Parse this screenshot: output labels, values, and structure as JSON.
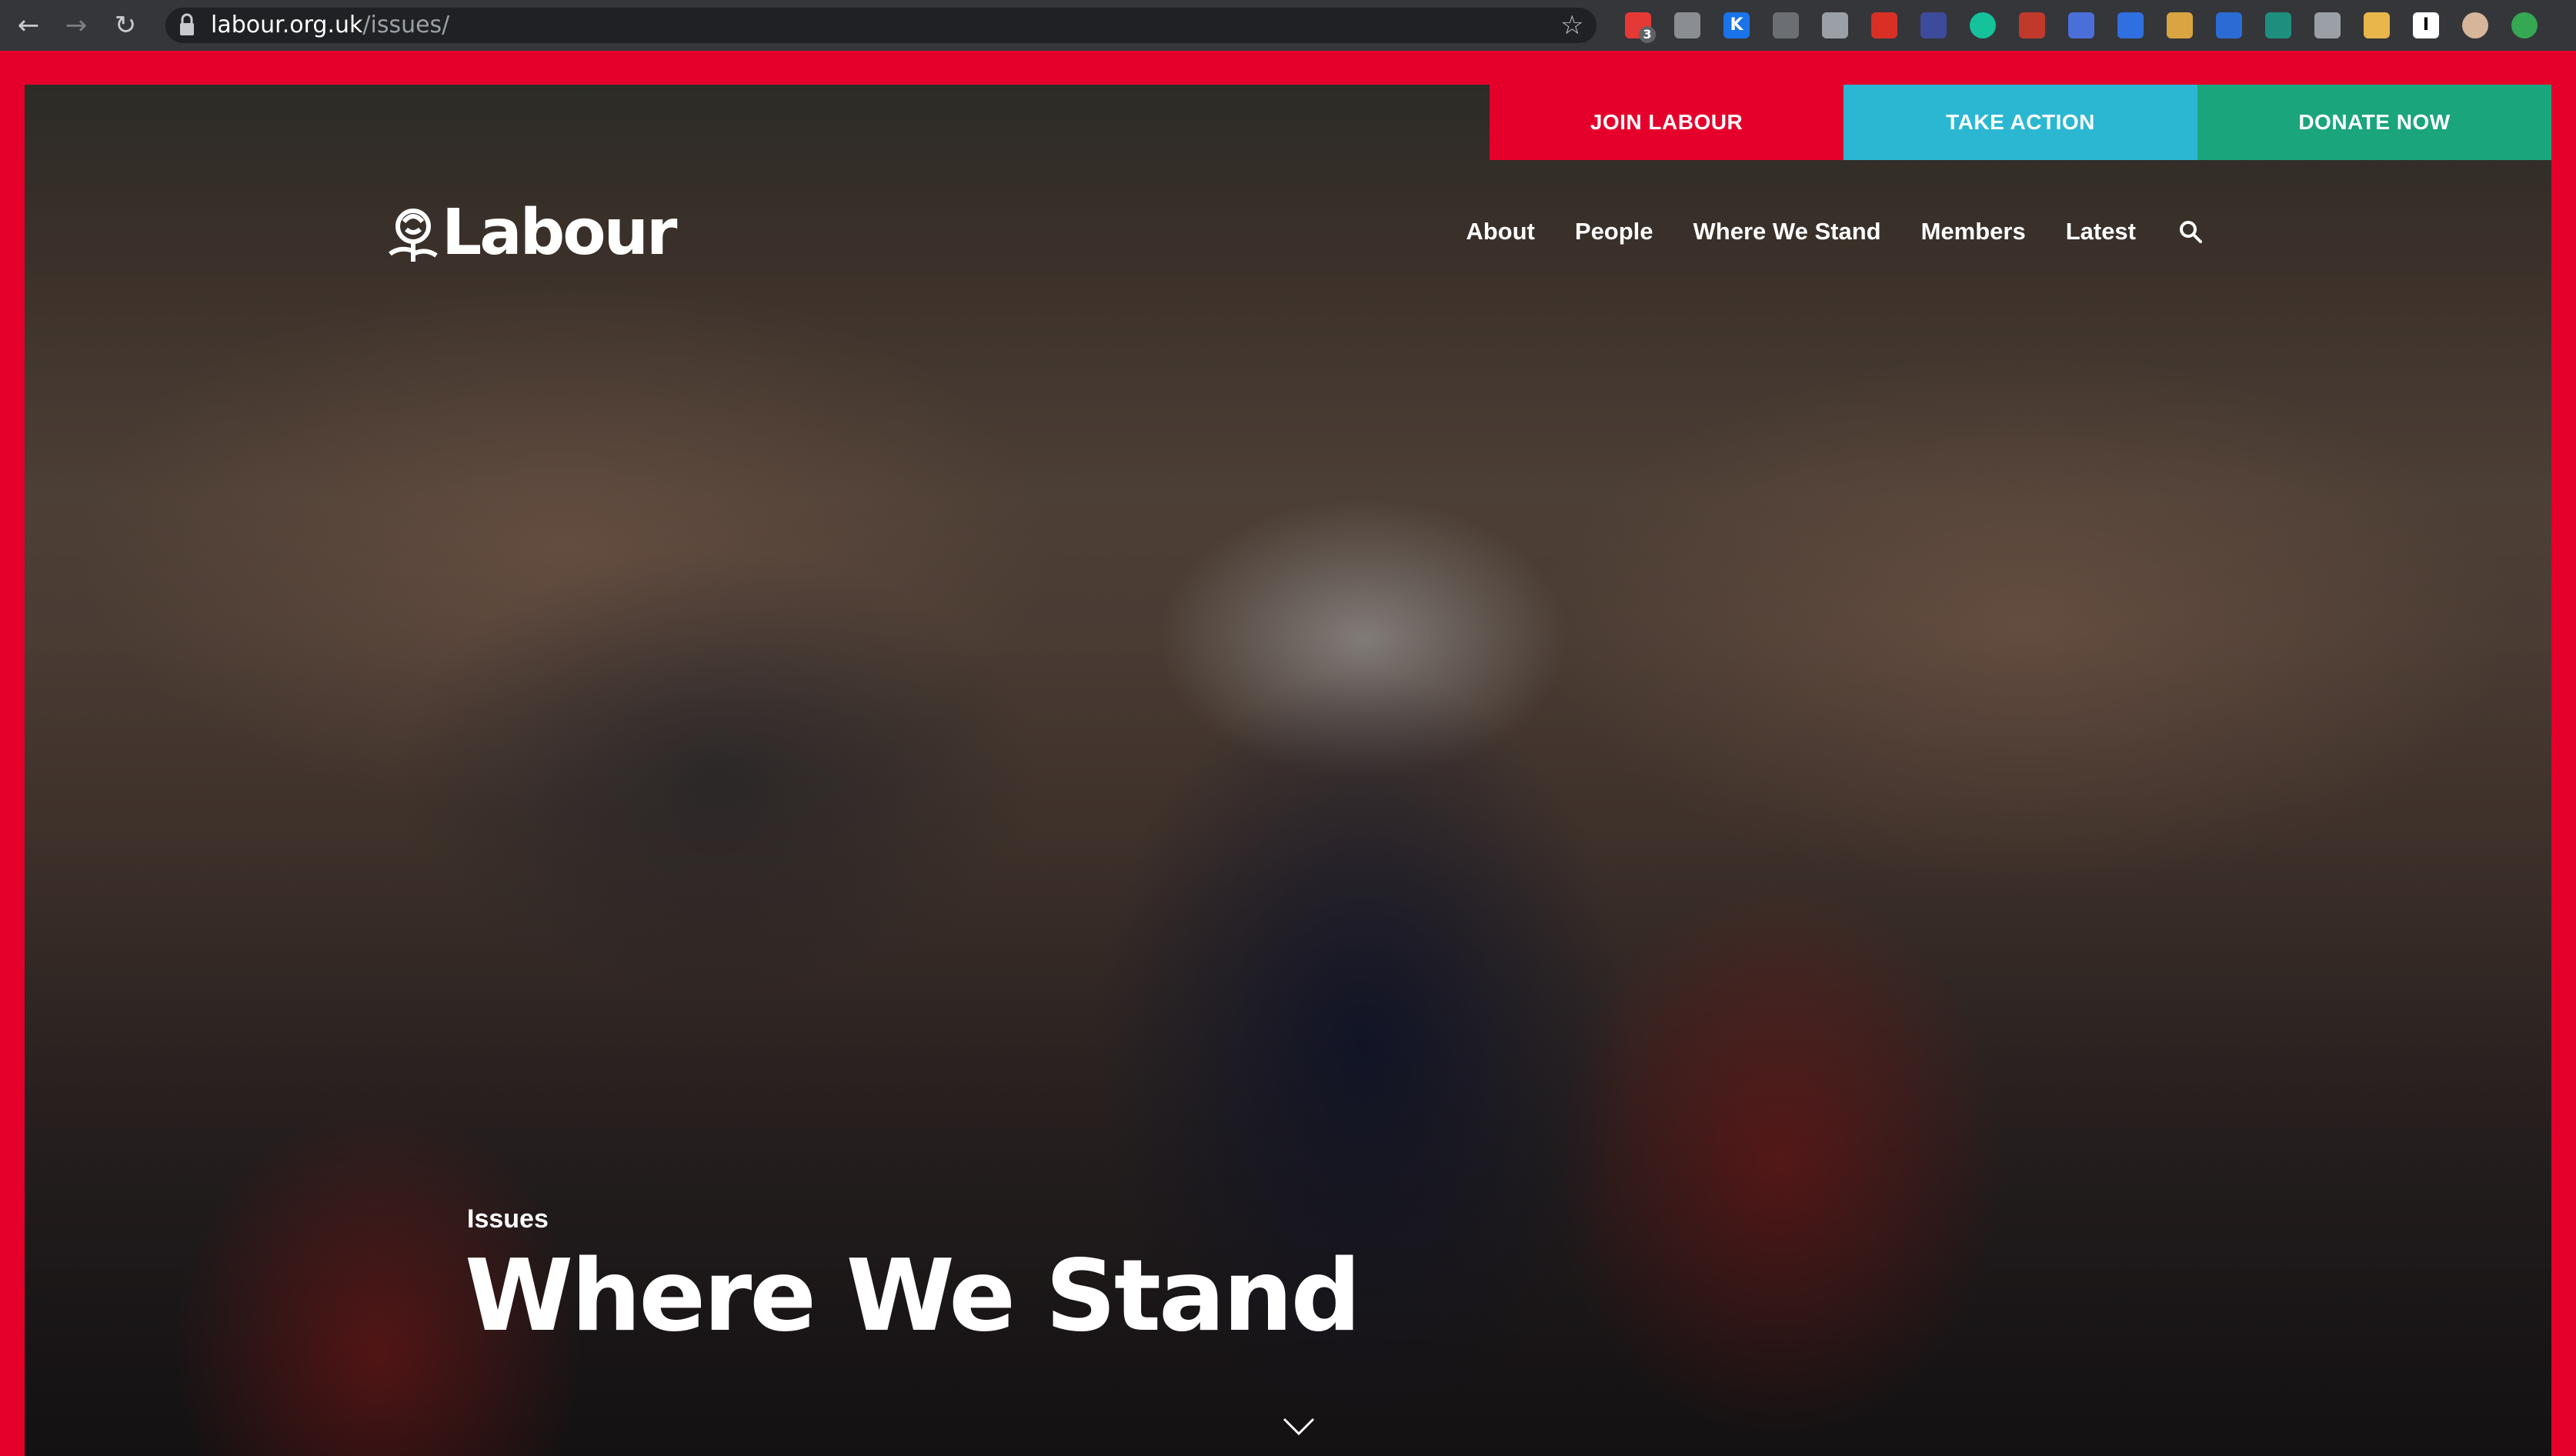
{
  "browser": {
    "url_host": "labour.org.uk",
    "url_path": "/issues/",
    "extension_badge": "3",
    "extensions": [
      {
        "icon": "red-badge-extension-icon",
        "color": "#e53935",
        "label": ""
      },
      {
        "icon": "camera-icon",
        "color": "#8a8d91",
        "label": ""
      },
      {
        "icon": "k-extension-icon",
        "color": "#1a73e8",
        "label": "K"
      },
      {
        "icon": "screen-extension-icon",
        "color": "#6b6e73",
        "label": ""
      },
      {
        "icon": "flag-extension-icon",
        "color": "#9aa0a6",
        "label": ""
      },
      {
        "icon": "pdf-extension-icon",
        "color": "#d93025",
        "label": ""
      },
      {
        "icon": "magnifier-extension-icon",
        "color": "#3c4b9b",
        "label": ""
      },
      {
        "icon": "grammarly-icon",
        "color": "#15c39a",
        "label": ""
      },
      {
        "icon": "window-extension-icon",
        "color": "#c0392b",
        "label": ""
      },
      {
        "icon": "tab-extension-icon",
        "color": "#4a6fd8",
        "label": ""
      },
      {
        "icon": "shield-icon",
        "color": "#2f6fe0",
        "label": ""
      },
      {
        "icon": "notes-extension-icon",
        "color": "#d9a441",
        "label": ""
      },
      {
        "icon": "gear-extension-icon",
        "color": "#2b6cd4",
        "label": ""
      },
      {
        "icon": "globe-extension-icon",
        "color": "#1e8e7e",
        "label": ""
      },
      {
        "icon": "copy-extension-icon",
        "color": "#9aa0a6",
        "label": ""
      },
      {
        "icon": "bell-extension-icon",
        "color": "#e8b64a",
        "label": ""
      },
      {
        "icon": "instapaper-icon",
        "color": "#ffffff",
        "label": "I"
      },
      {
        "icon": "avatar-icon",
        "color": "#d7b59a",
        "label": ""
      },
      {
        "icon": "update-arrow-icon",
        "color": "#34a853",
        "label": ""
      }
    ]
  },
  "cta": {
    "join": "JOIN LABOUR",
    "action": "TAKE ACTION",
    "donate": "DONATE NOW"
  },
  "logo": {
    "text": "Labour",
    "icon": "rose-logo-icon"
  },
  "nav": {
    "items": [
      "About",
      "People",
      "Where We Stand",
      "Members",
      "Latest"
    ],
    "search_icon": "search-icon"
  },
  "hero": {
    "kicker": "Issues",
    "title": "Where We Stand",
    "scroll_icon": "chevron-down-icon"
  },
  "colors": {
    "brand_red": "#e4002b",
    "action_blue": "#2bb7d2",
    "donate_green": "#1aa57c",
    "chrome_bg": "#35363a"
  }
}
